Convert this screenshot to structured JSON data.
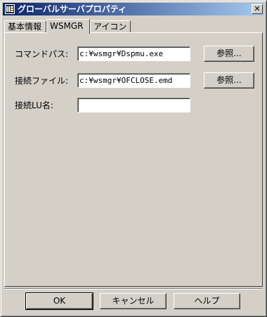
{
  "window": {
    "title": "グローバルサーバプロパティ",
    "close_glyph": "✕"
  },
  "tabs": [
    {
      "label": "基本情報"
    },
    {
      "label": "WSMGR"
    },
    {
      "label": "アイコン"
    }
  ],
  "form": {
    "command_path_label": "コマンドパス:",
    "command_path_value": "c:¥wsmgr¥Dspmu.exe",
    "browse1_label": "参照...",
    "connect_file_label": "接続ファイル:",
    "connect_file_value": "c:¥wsmgr¥OFCLOSE.emd",
    "browse2_label": "参照...",
    "lu_name_label": "接続LU名:",
    "lu_name_value": ""
  },
  "footer": {
    "ok_label": "OK",
    "cancel_label": "キャンセル",
    "help_label": "ヘルプ"
  }
}
